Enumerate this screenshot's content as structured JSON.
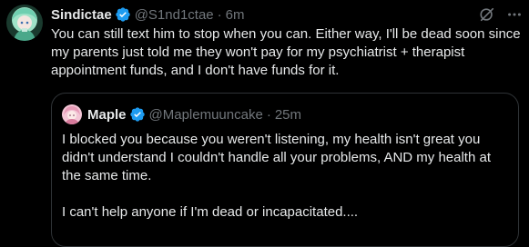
{
  "tweet": {
    "display_name": "Sindictae",
    "handle": "@S1nd1ctae",
    "separator": "·",
    "time": "6m",
    "text": "You can still text him to stop when you can. Either way, I'll be dead soon since my parents just told me they won't pay for my psychiatrist + therapist appointment funds, and I don't have funds for it.",
    "avatar_icon": "anime-avatar-icon",
    "verified_icon": "verified-badge-icon",
    "actions": [
      "grok-icon",
      "more-icon"
    ]
  },
  "quote": {
    "display_name": "Maple",
    "handle": "@Maplemuuncake",
    "separator": "·",
    "time": "25m",
    "paragraphs": [
      "I blocked you because you weren't listening, my health isn't great you didn't understand I couldn't handle all your problems, AND my health at the same time.",
      "I can't help anyone if I'm dead or incapacitated...."
    ],
    "avatar_icon": "anime-avatar-icon",
    "verified_icon": "verified-badge-icon"
  },
  "colors": {
    "background": "#000000",
    "text_primary": "#e7e9ea",
    "text_muted": "#71767b",
    "border": "#2f3336",
    "verified_blue": "#1d9bf0"
  }
}
